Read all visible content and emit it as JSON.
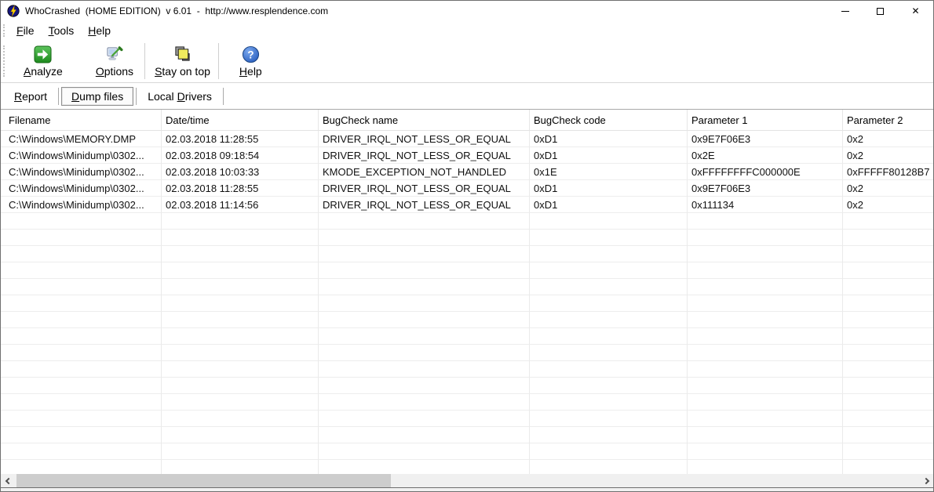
{
  "window": {
    "title": "WhoCrashed  (HOME EDITION)  v 6.01  -  http://www.resplendence.com",
    "controls": {
      "close_glyph": "✕"
    }
  },
  "menu": {
    "items": [
      {
        "pre": "",
        "key": "F",
        "post": "ile"
      },
      {
        "pre": "",
        "key": "T",
        "post": "ools"
      },
      {
        "pre": "",
        "key": "H",
        "post": "elp"
      }
    ]
  },
  "toolbar": {
    "buttons": [
      {
        "pre": "",
        "key": "A",
        "post": "nalyze"
      },
      {
        "pre": "",
        "key": "O",
        "post": "ptions"
      },
      {
        "pre": "",
        "key": "S",
        "post": "tay on top"
      },
      {
        "pre": "",
        "key": "H",
        "post": "elp"
      }
    ]
  },
  "tabs": [
    {
      "pre": "",
      "key": "R",
      "post": "eport",
      "active": false
    },
    {
      "pre": "",
      "key": "D",
      "post": "ump files",
      "active": true
    },
    {
      "pre": "Local ",
      "key": "D",
      "post": "rivers",
      "active": false
    }
  ],
  "table": {
    "columns": [
      "Filename",
      "Date/time",
      "BugCheck name",
      "BugCheck code",
      "Parameter 1",
      "Parameter 2"
    ],
    "rows": [
      [
        "C:\\Windows\\MEMORY.DMP",
        "02.03.2018 11:28:55",
        "DRIVER_IRQL_NOT_LESS_OR_EQUAL",
        "0xD1",
        "0x9E7F06E3",
        "0x2"
      ],
      [
        "C:\\Windows\\Minidump\\0302...",
        "02.03.2018 09:18:54",
        "DRIVER_IRQL_NOT_LESS_OR_EQUAL",
        "0xD1",
        "0x2E",
        "0x2"
      ],
      [
        "C:\\Windows\\Minidump\\0302...",
        "02.03.2018 10:03:33",
        "KMODE_EXCEPTION_NOT_HANDLED",
        "0x1E",
        "0xFFFFFFFFC000000E",
        "0xFFFFF80128B7"
      ],
      [
        "C:\\Windows\\Minidump\\0302...",
        "02.03.2018 11:28:55",
        "DRIVER_IRQL_NOT_LESS_OR_EQUAL",
        "0xD1",
        "0x9E7F06E3",
        "0x2"
      ],
      [
        "C:\\Windows\\Minidump\\0302...",
        "02.03.2018 11:14:56",
        "DRIVER_IRQL_NOT_LESS_OR_EQUAL",
        "0xD1",
        "0x111134",
        "0x2"
      ]
    ]
  },
  "icons": {
    "app-icon": "dark globe with yellow lightning bolt",
    "analyze-icon": "green square with white right arrow",
    "options-icon": "monitor with green screwdriver",
    "stay-on-top-icon": "overlapping gray and yellow windows",
    "help-icon": "blue circle with white question mark"
  },
  "colors": {
    "analyze_green": "#2e9b2e",
    "help_blue": "#2f6fd6",
    "stay_on_top_yellow": "#efeb5e",
    "gridline": "#ededed",
    "scroll_thumb": "#cdcdcd",
    "scroll_track": "#f0f0f0"
  }
}
